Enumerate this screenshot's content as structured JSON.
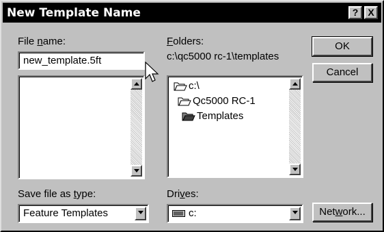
{
  "window": {
    "title": "New Template Name",
    "help_label": "?",
    "close_label": "X"
  },
  "filename": {
    "label_pre": "File ",
    "label_key": "n",
    "label_post": "ame:",
    "value": "new_template.5ft"
  },
  "folders": {
    "label_key": "F",
    "label_post": "olders:",
    "current_path": "c:\\qc5000 rc-1\\templates",
    "items": [
      {
        "name": "c:\\",
        "icon": "open-folder-icon"
      },
      {
        "name": "Qc5000 RC-1",
        "icon": "open-folder-icon"
      },
      {
        "name": "Templates",
        "icon": "open-folder-selected-icon"
      }
    ]
  },
  "filetype": {
    "label_pre": "Save file as ",
    "label_key": "t",
    "label_post": "ype:",
    "value": "Feature Templates"
  },
  "drives": {
    "label_pre": "Dri",
    "label_key": "v",
    "label_post": "es:",
    "value": "c:",
    "icon": "hard-drive-icon"
  },
  "buttons": {
    "ok": "OK",
    "cancel": "Cancel",
    "network_pre": "Net",
    "network_key": "w",
    "network_post": "ork..."
  },
  "colors": {
    "face": "#c0c0c0",
    "titlebar": "#000000",
    "field": "#ffffff"
  }
}
